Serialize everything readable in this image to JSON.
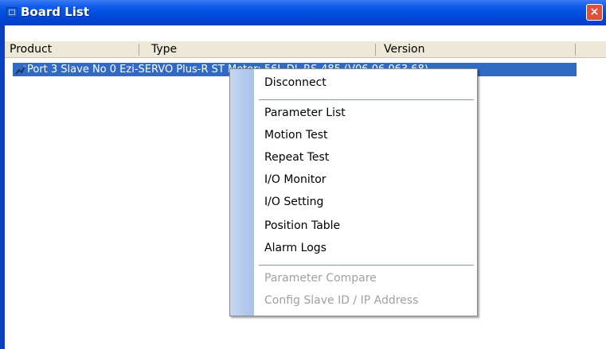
{
  "window": {
    "title": "Board List",
    "close_label": "×"
  },
  "table": {
    "columns": [
      "Product",
      "Type",
      "Version"
    ],
    "row_text": "Port 3 Slave No 0  Ezi-SERVO Plus-R ST   Motor: 56L DL    RS-485 (V06.06.063.68)"
  },
  "context_menu": {
    "groups": [
      [
        {
          "label": "Disconnect",
          "enabled": true
        }
      ],
      [
        {
          "label": "Parameter List",
          "enabled": true
        },
        {
          "label": "Motion Test",
          "enabled": true
        },
        {
          "label": "Repeat Test",
          "enabled": true
        },
        {
          "label": "I/O Monitor",
          "enabled": true
        },
        {
          "label": "I/O Setting",
          "enabled": true
        },
        {
          "label": "Position Table",
          "enabled": true
        },
        {
          "label": "Alarm Logs",
          "enabled": true
        }
      ],
      [
        {
          "label": "Parameter Compare",
          "enabled": false
        },
        {
          "label": "Config Slave ID / IP Address",
          "enabled": false
        }
      ]
    ]
  },
  "colors": {
    "titlebar": "#0a5ae8",
    "selection": "#316ac5",
    "menu_strip": "#b7cdee",
    "close_button": "#e0503a",
    "disabled_text": "#a0a0a0"
  },
  "icons": [
    "window-icon",
    "close-icon",
    "device-icon"
  ]
}
